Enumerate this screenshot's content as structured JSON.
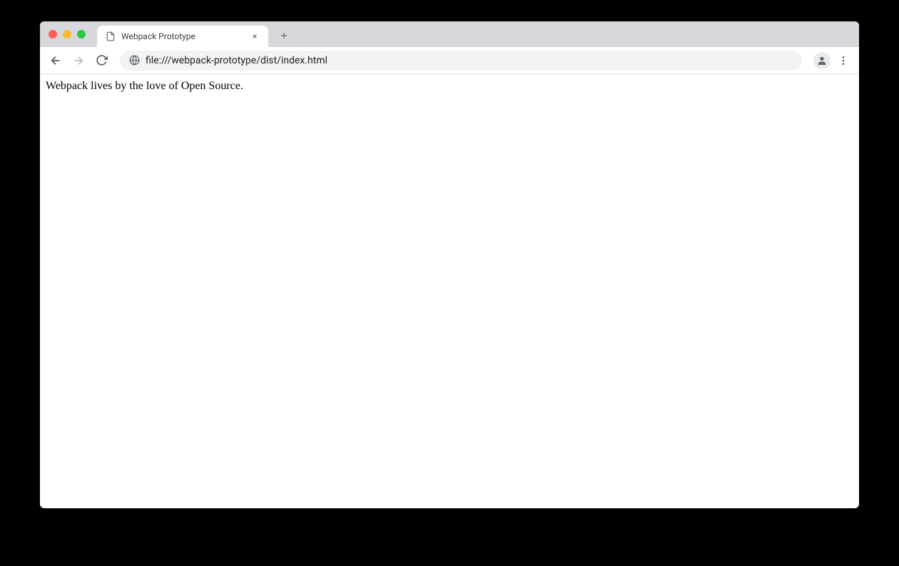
{
  "tab": {
    "title": "Webpack Prototype"
  },
  "address": {
    "url": "file:///webpack-prototype/dist/index.html"
  },
  "page": {
    "body_text": "Webpack lives by the love of Open Source."
  }
}
